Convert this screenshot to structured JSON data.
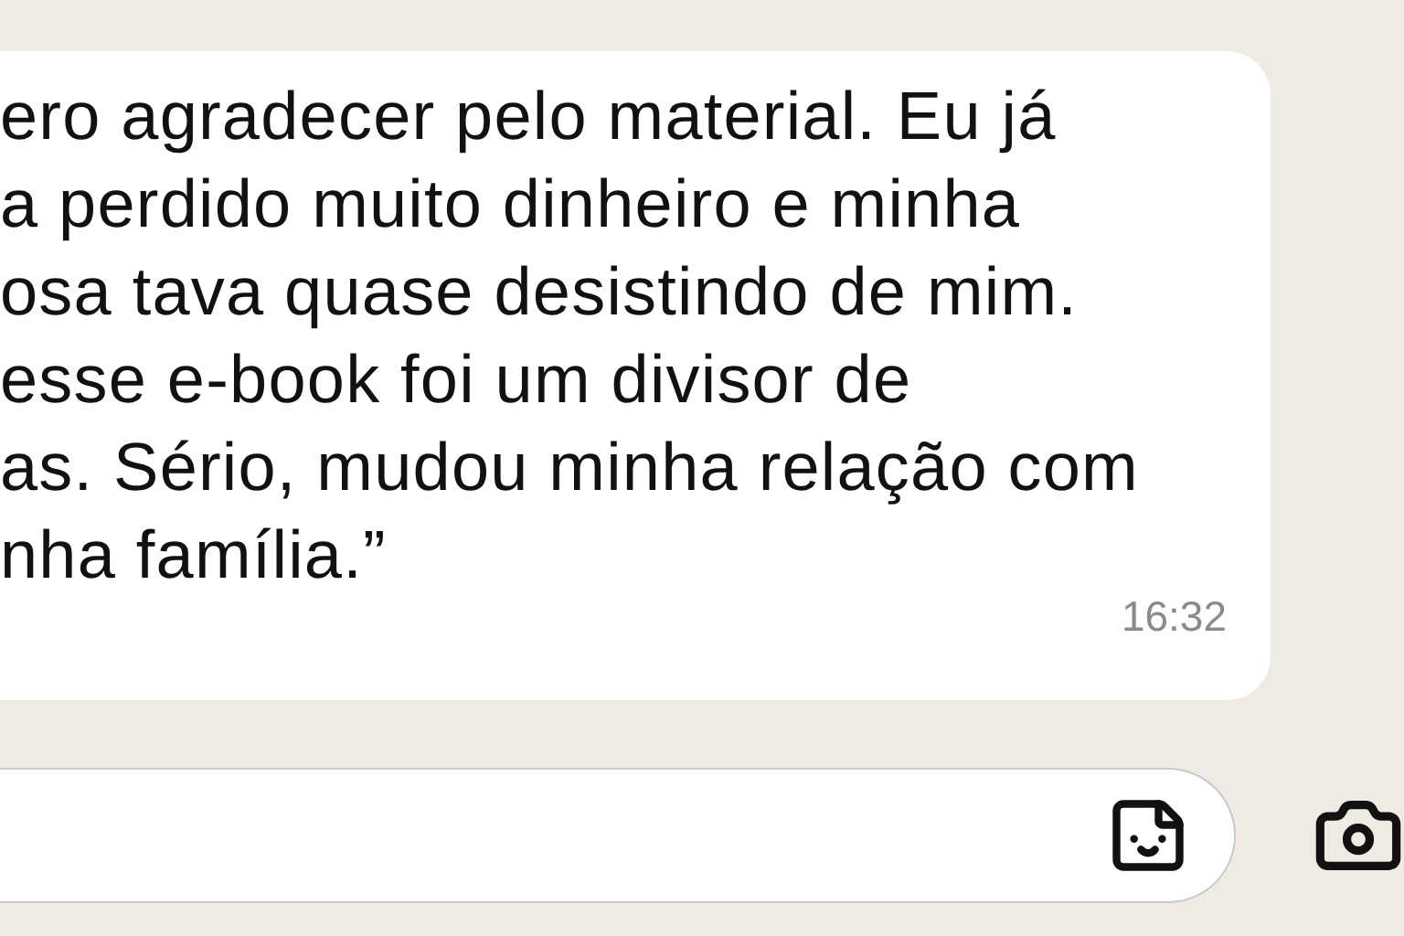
{
  "message": {
    "text": "ero agradecer pelo material. Eu já\na perdido muito dinheiro e minha\nosa tava quase desistindo de mim.\nesse e-book foi um divisor de\nas. Sério, mudou minha relação com\nnha família.”",
    "time": "16:32"
  }
}
